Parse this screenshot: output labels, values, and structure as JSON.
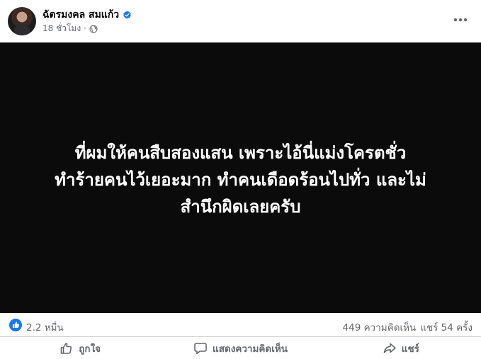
{
  "post": {
    "author": "ฉัตรมงคล สมแก้ว",
    "timestamp": "18 ชั่วโมง ·",
    "privacy_icon": "globe-icon",
    "verified_icon": "verified-badge-icon",
    "more_icon": "more-options-icon",
    "image_background": "#0b0b0b",
    "quote_lines": [
      "ที่ผมให้คนสืบสองแสน เพราะไอ้นี่แม่งโครตชั่ว",
      "ทำร้ายคนไว้เยอะมาก ทำคนเดือดร้อนไปทั่ว และไม่",
      "สำนึกผิดเลยครับ"
    ]
  },
  "stats": {
    "reaction_count": "2.2 หมื่น",
    "comments": "449 ความคิดเห็น",
    "shares": "แชร์ 54 ครั้ง",
    "reaction_icon": "like-reaction-icon",
    "accent_color": "#1877f2"
  },
  "actions": {
    "like_label": "ถูกใจ",
    "comment_label": "แสดงความคิดเห็น",
    "share_label": "แชร์"
  }
}
